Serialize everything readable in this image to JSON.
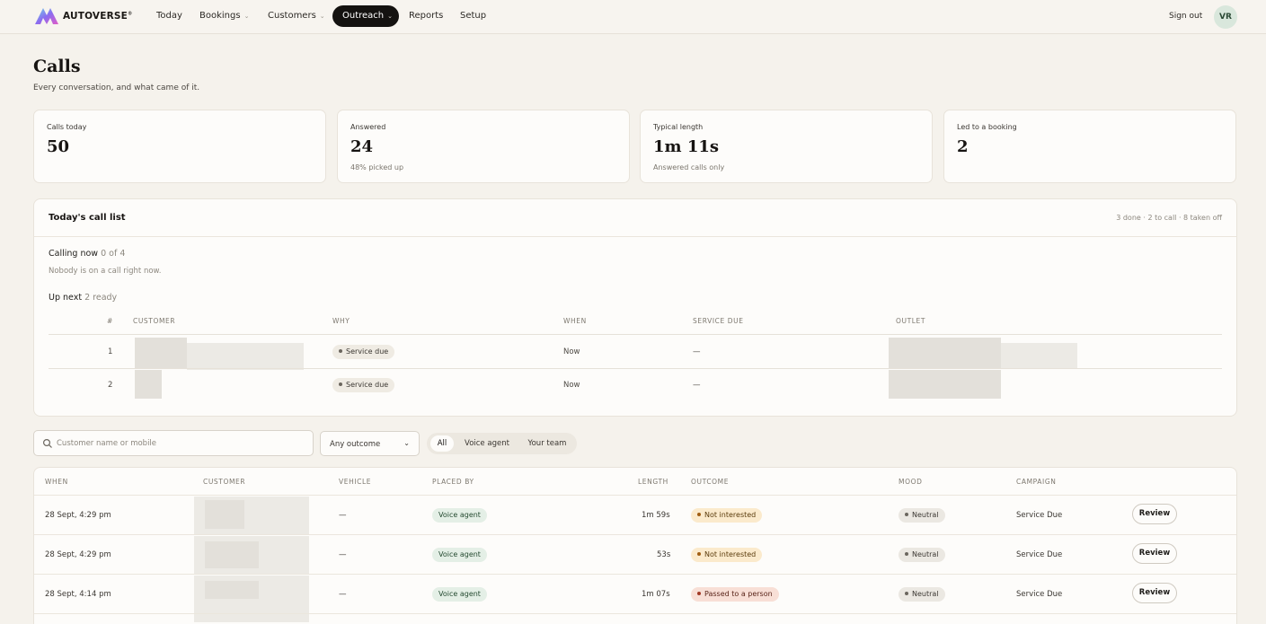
{
  "nav": {
    "brand": "AUTOVERSE",
    "brand_mark": "®",
    "items": [
      {
        "label": "Today"
      },
      {
        "label": "Bookings"
      },
      {
        "label": "Customers"
      },
      {
        "label": "Outreach"
      },
      {
        "label": "Reports"
      },
      {
        "label": "Setup"
      }
    ],
    "sign_out": "Sign out",
    "avatar_initials": "VR"
  },
  "page": {
    "title": "Calls",
    "subtitle": "Every conversation, and what came of it."
  },
  "stats": [
    {
      "label": "Calls today",
      "value": "50",
      "note": ""
    },
    {
      "label": "Answered",
      "value": "24",
      "note": "48% picked up"
    },
    {
      "label": "Typical length",
      "value": "1m 11s",
      "note": "Answered calls only"
    },
    {
      "label": "Led to a booking",
      "value": "2",
      "note": ""
    }
  ],
  "call_list": {
    "title": "Today's call list",
    "meta": "3 done · 2 to call · 8 taken off",
    "calling_now_label": "Calling now",
    "calling_now_count": "0 of 4",
    "calling_now_note": "Nobody is on a call right now.",
    "up_next_label": "Up next",
    "up_next_count": "2 ready",
    "headers": [
      "#",
      "CUSTOMER",
      "WHY",
      "WHEN",
      "SERVICE DUE",
      "OUTLET"
    ],
    "rows": [
      {
        "num": "1",
        "why": "Service due",
        "when": "Now",
        "service_due": "—"
      },
      {
        "num": "2",
        "why": "Service due",
        "when": "Now",
        "service_due": "—"
      }
    ]
  },
  "filters": {
    "search_placeholder": "Customer name or mobile",
    "outcome_select": "Any outcome",
    "segments": [
      "All",
      "Voice agent",
      "Your team"
    ]
  },
  "calls_table": {
    "headers": [
      "WHEN",
      "CUSTOMER",
      "VEHICLE",
      "PLACED BY",
      "LENGTH",
      "OUTCOME",
      "MOOD",
      "CAMPAIGN"
    ],
    "rows": [
      {
        "when": "28 Sept, 4:29 pm",
        "vehicle": "—",
        "placed_by": "Voice agent",
        "length": "1m 59s",
        "outcome": "Not interested",
        "mood": "Neutral",
        "campaign": "Service Due",
        "action": "Review"
      },
      {
        "when": "28 Sept, 4:29 pm",
        "vehicle": "—",
        "placed_by": "Voice agent",
        "length": "53s",
        "outcome": "Not interested",
        "mood": "Neutral",
        "campaign": "Service Due",
        "action": "Review"
      },
      {
        "when": "28 Sept, 4:14 pm",
        "vehicle": "—",
        "placed_by": "Voice agent",
        "length": "1m 07s",
        "outcome": "Passed to a person",
        "mood": "Neutral",
        "campaign": "Service Due",
        "action": "Review"
      }
    ]
  }
}
